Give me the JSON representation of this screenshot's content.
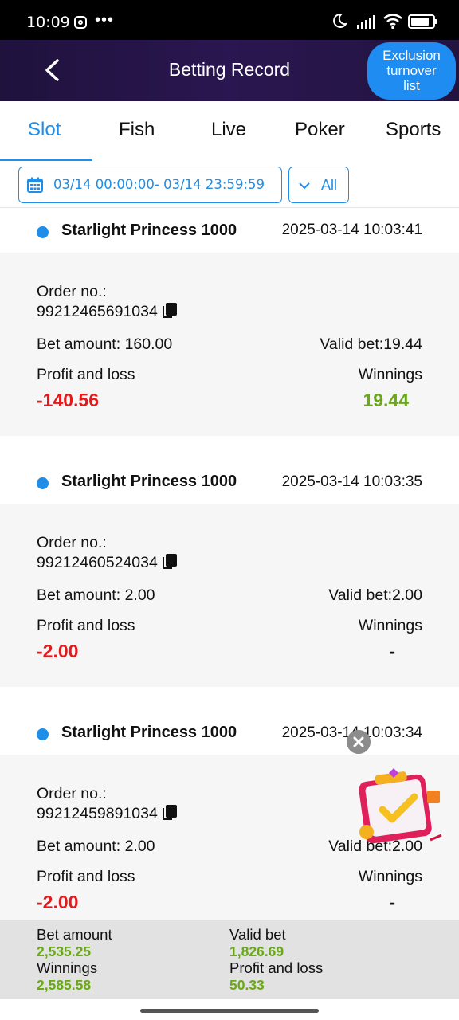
{
  "status_bar": {
    "time": "10:09",
    "dots": "•••"
  },
  "header": {
    "title": "Betting Record",
    "exclusion_button": "Exclusion turnover list",
    "exclusion_line1": "Exclusion",
    "exclusion_line2": "turnover",
    "exclusion_line3": "list"
  },
  "tabs": [
    "Slot",
    "Fish",
    "Live",
    "Poker",
    "Sports"
  ],
  "active_tab": "Slot",
  "filters": {
    "date_range": "03/14 00:00:00- 03/14 23:59:59",
    "type": "All"
  },
  "labels": {
    "order_no": "Order no.:",
    "bet_amount": "Bet amount: ",
    "valid_bet": "Valid bet:",
    "profit_and_loss": "Profit and loss",
    "winnings": "Winnings"
  },
  "records": [
    {
      "game": "Starlight Princess 1000",
      "time": "2025-03-14 10:03:41",
      "order_no": "99212465691034",
      "bet_amount": "Bet amount: 160.00",
      "valid_bet": "Valid bet:19.44",
      "profit_loss": "-140.56",
      "winnings": "19.44"
    },
    {
      "game": "Starlight Princess 1000",
      "time": "2025-03-14 10:03:35",
      "order_no": "99212460524034",
      "bet_amount": "Bet amount: 2.00",
      "valid_bet": "Valid bet:2.00",
      "profit_loss": "-2.00",
      "winnings": "-"
    },
    {
      "game": "Starlight Princess 1000",
      "time": "2025-03-14 10:03:34",
      "order_no": "99212459891034",
      "bet_amount": "Bet amount: 2.00",
      "valid_bet": "Valid bet:2.00",
      "profit_loss": "-2.00",
      "winnings": "-"
    }
  ],
  "summary": {
    "bet_amount_label": "Bet amount",
    "bet_amount": "2,535.25",
    "valid_bet_label": "Valid bet",
    "valid_bet": "1,826.69",
    "winnings_label": "Winnings",
    "winnings": "2,585.58",
    "profit_loss_label": "Profit and loss",
    "profit_loss": "50.33"
  },
  "colors": {
    "accent": "#1e8ee8",
    "loss": "#e11b1b",
    "win": "#6aa81a",
    "header_bg": "#22143f"
  }
}
